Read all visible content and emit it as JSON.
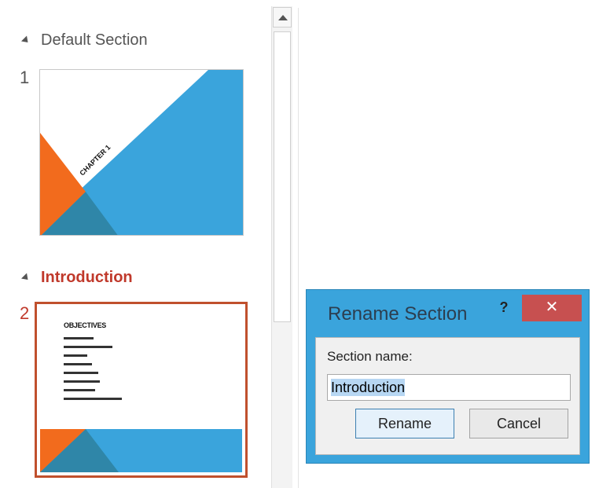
{
  "sections": [
    {
      "name": "Default Section",
      "active": false
    },
    {
      "name": "Introduction",
      "active": true
    }
  ],
  "slides": [
    {
      "number": "1",
      "title": "CHAPTER 1"
    },
    {
      "number": "2",
      "title": "OBJECTIVES"
    }
  ],
  "dialog": {
    "title": "Rename Section",
    "help_label": "?",
    "close_label": "✕",
    "field_label": "Section name:",
    "field_value": "Introduction",
    "rename_label": "Rename",
    "cancel_label": "Cancel"
  },
  "colors": {
    "accent_blue": "#3aa4dc",
    "accent_orange": "#f26b1d",
    "active_section": "#c0392b",
    "close_red": "#c75050"
  }
}
